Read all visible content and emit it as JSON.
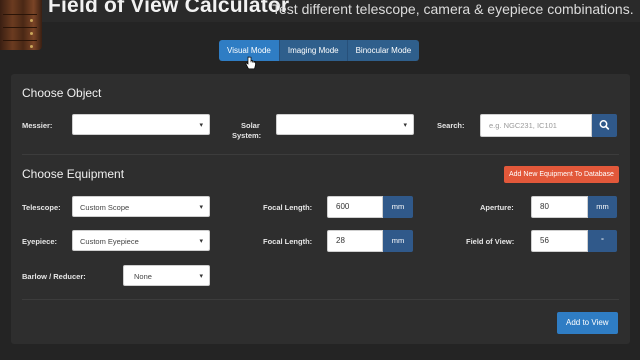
{
  "header": {
    "title": "Field of View Calculator",
    "subtitle": "Test different telescope, camera & eyepiece combinations."
  },
  "modes": [
    {
      "label": "Visual Mode",
      "active": true
    },
    {
      "label": "Imaging Mode",
      "active": false
    },
    {
      "label": "Binocular Mode",
      "active": false
    }
  ],
  "object": {
    "title": "Choose Object",
    "messier_label": "Messier:",
    "solar_label_1": "Solar",
    "solar_label_2": "System:",
    "search_label": "Search:",
    "search_placeholder": "e.g. NGC231, IC101"
  },
  "equipment": {
    "title": "Choose Equipment",
    "add_button": "Add New Equipment To Database",
    "telescope_label": "Telescope:",
    "telescope_value": "Custom Scope",
    "scope_focal_label": "Focal Length:",
    "scope_focal_value": "600",
    "scope_focal_unit": "mm",
    "aperture_label": "Aperture:",
    "aperture_value": "80",
    "aperture_unit": "mm",
    "eyepiece_label": "Eyepiece:",
    "eyepiece_value": "Custom Eyepiece",
    "ep_focal_label": "Focal Length:",
    "ep_focal_value": "28",
    "ep_focal_unit": "mm",
    "fov_label": "Field of View:",
    "fov_value": "56",
    "fov_unit": "°",
    "barlow_label": "Barlow / Reducer:",
    "barlow_value": "None"
  },
  "actions": {
    "add_to_view": "Add to View"
  },
  "colors": {
    "background": "#242424",
    "panel": "#2e2e2e",
    "primary": "#2f7dc4",
    "addon": "#30598a",
    "danger": "#e2583a"
  }
}
